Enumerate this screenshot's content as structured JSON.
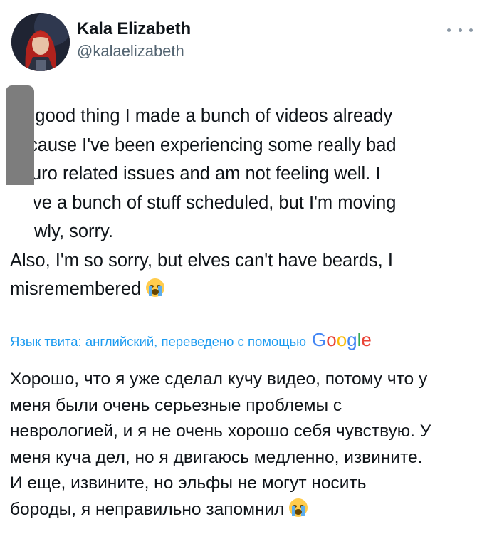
{
  "author": {
    "display_name": "Kala Elizabeth",
    "handle": "@kalaelizabeth",
    "avatar_icon": "profile-avatar-icon"
  },
  "tweet": {
    "lines": [
      ": a good thing I made a bunch of videos already",
      "cause I've been experiencing some really bad",
      "uro related issues and am not feeling well. I",
      "ve a bunch of stuff scheduled, but I'm moving",
      "wly, sorry.",
      "Also, I'm so sorry, but elves can't have beards, I",
      "misremembered"
    ]
  },
  "translation": {
    "meta_label": "Язык твита: английский, переведено с помощью",
    "provider": "Google",
    "lines": [
      "Хорошо, что я уже сделал кучу видео, потому что у",
      "меня были очень серьезные проблемы с",
      "неврологией, и я не очень хорошо себя чувствую. У",
      "меня куча дел, но я двигаюсь медленно, извините.",
      "И еще, извините, но эльфы не могут носить",
      "бороды, я неправильно запомнил"
    ]
  },
  "colors": {
    "link": "#1d9bf0",
    "secondary": "#536471",
    "text": "#0f1419"
  },
  "icons": {
    "more": "more-options-icon",
    "emoji": "crying-face-emoji-icon"
  }
}
